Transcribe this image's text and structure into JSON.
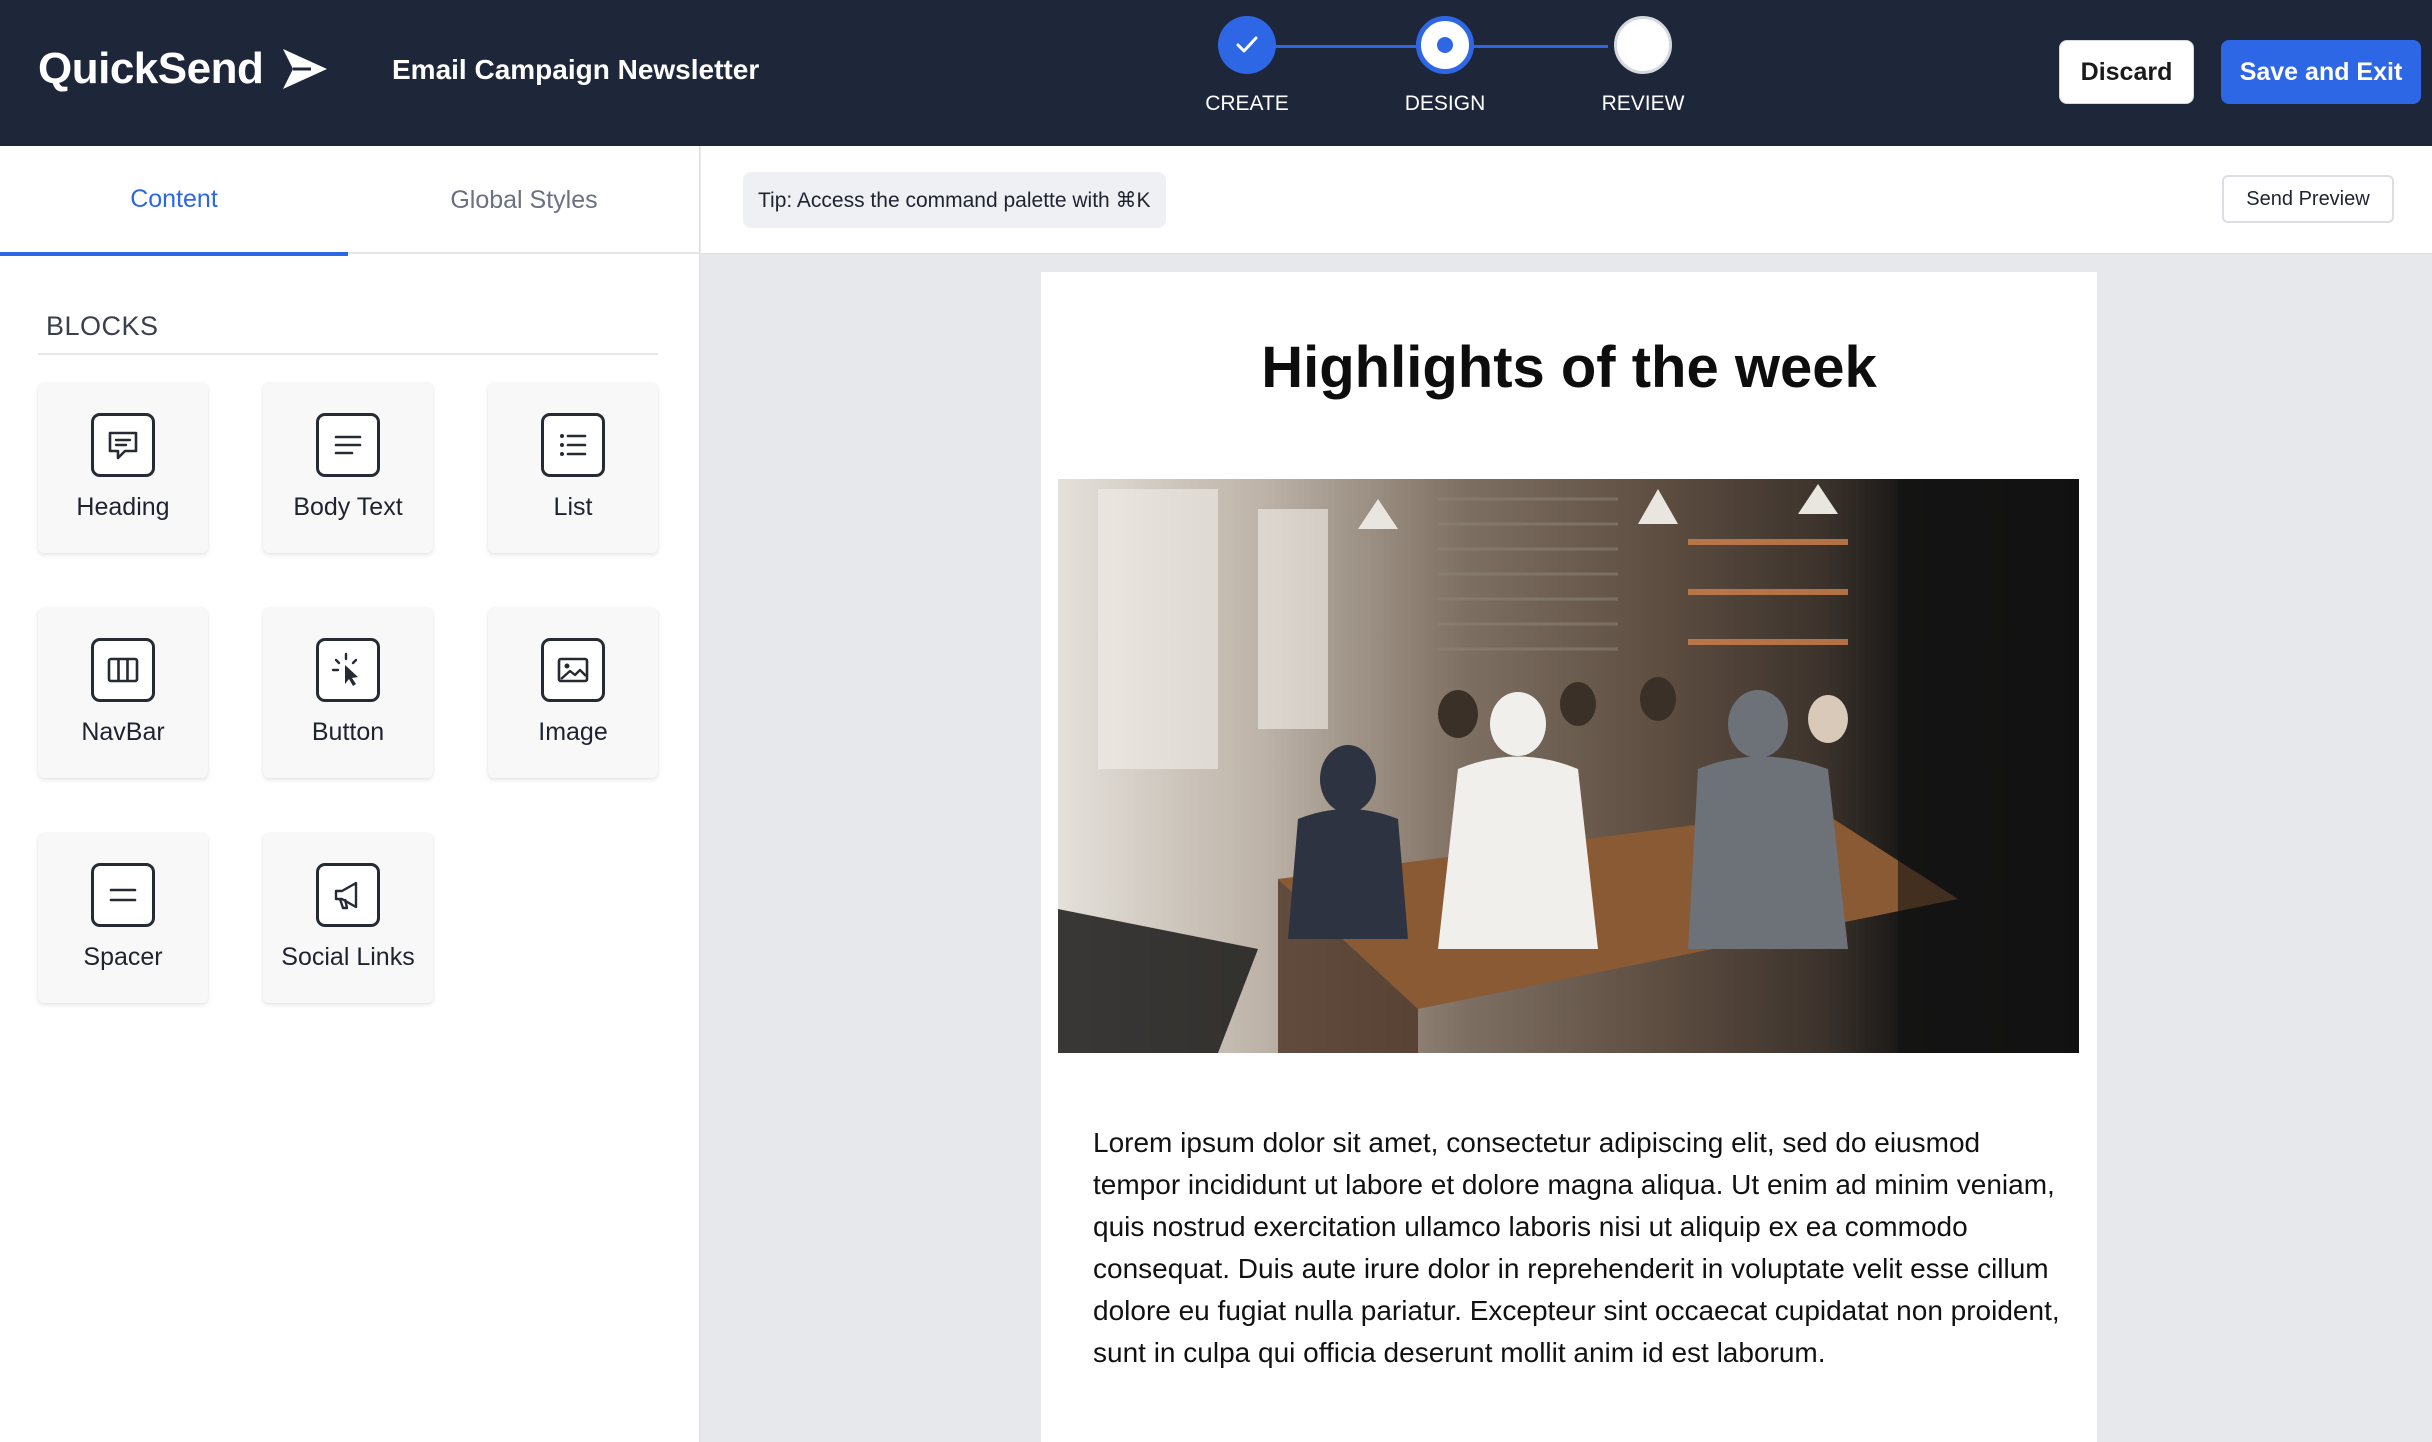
{
  "header": {
    "brand_name": "QuickSend",
    "campaign_title": "Email Campaign Newsletter",
    "steps": [
      {
        "label": "CREATE",
        "state": "done"
      },
      {
        "label": "DESIGN",
        "state": "current"
      },
      {
        "label": "REVIEW",
        "state": "todo"
      }
    ],
    "discard_label": "Discard",
    "save_label": "Save and Exit"
  },
  "sidebar": {
    "tabs": [
      {
        "label": "Content",
        "active": true
      },
      {
        "label": "Global Styles",
        "active": false
      }
    ],
    "section_title": "BLOCKS",
    "blocks": [
      {
        "label": "Heading",
        "icon": "chat-bubble-icon"
      },
      {
        "label": "Body Text",
        "icon": "text-lines-icon"
      },
      {
        "label": "List",
        "icon": "bulleted-list-icon"
      },
      {
        "label": "NavBar",
        "icon": "columns-icon"
      },
      {
        "label": "Button",
        "icon": "click-pointer-icon"
      },
      {
        "label": "Image",
        "icon": "picture-icon"
      },
      {
        "label": "Spacer",
        "icon": "spacer-lines-icon"
      },
      {
        "label": "Social Links",
        "icon": "megaphone-icon"
      }
    ]
  },
  "toolbar": {
    "tip": "Tip: Access the command palette with ⌘K",
    "send_preview_label": "Send Preview"
  },
  "email": {
    "heading": "Highlights of the week",
    "image_description_icon": "team-meeting-photo",
    "body": "Lorem ipsum dolor sit amet, consectetur adipiscing elit, sed do eiusmod tempor incididunt ut labore et dolore magna aliqua. Ut enim ad minim veniam, quis nostrud exercitation ullamco laboris nisi ut aliquip ex ea commodo consequat. Duis aute irure dolor in reprehenderit in voluptate velit esse cillum dolore eu fugiat nulla pariatur. Excepteur sint occaecat cupidatat non proident, sunt in culpa qui officia deserunt mollit anim id est laborum."
  },
  "colors": {
    "header_bg": "#1e263a",
    "accent": "#2e67e6",
    "canvas_bg": "#e7e8ec"
  }
}
